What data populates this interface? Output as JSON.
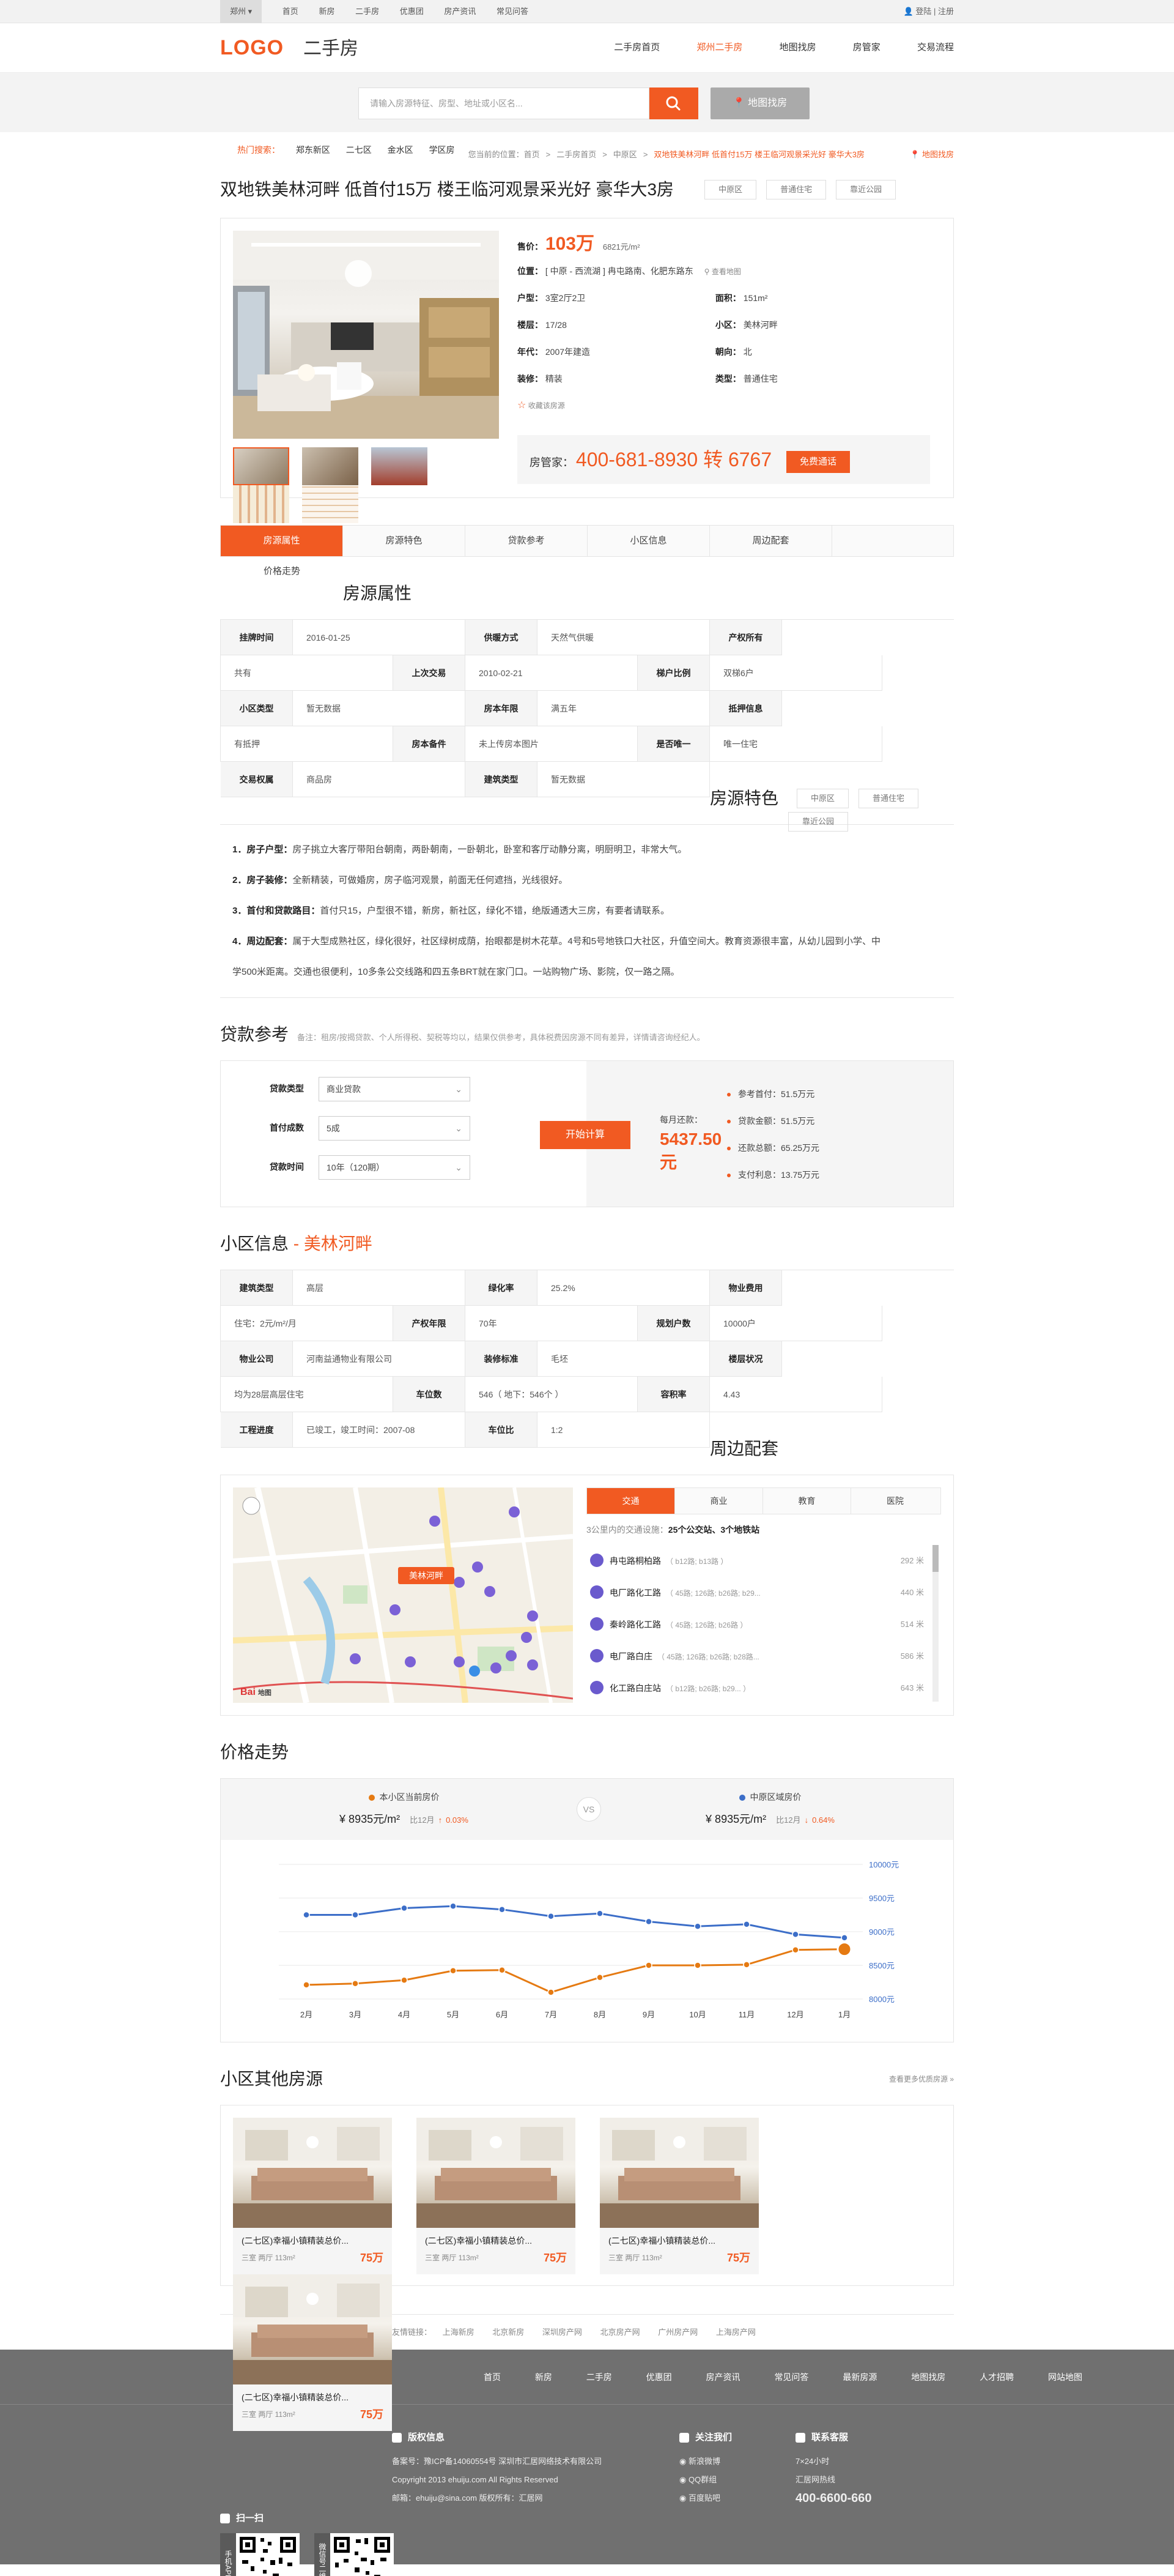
{
  "topbar": {
    "city": "郑州",
    "links": [
      "首页",
      "新房",
      "二手房",
      "优惠团",
      "房产资讯",
      "常见问答"
    ],
    "login": "登陆",
    "sep": "|",
    "register": "注册"
  },
  "header": {
    "logo": "LOGO",
    "site_name": "二手房",
    "nav": [
      "二手房首页",
      "郑州二手房",
      "地图找房",
      "房管家",
      "交易流程"
    ],
    "nav_active": 1
  },
  "search": {
    "placeholder": "请输入房源特征、房型、地址或小区名...",
    "map_button": "地图找房",
    "hot_label": "热门搜索：",
    "hot": [
      "郑东新区",
      "二七区",
      "金水区",
      "学区房"
    ]
  },
  "breadcrumb": {
    "prefix": "您当前的位置：",
    "items": [
      "首页",
      "二手房首页",
      "中原区"
    ],
    "current": "双地铁美林河畔 低首付15万 楼王临河观景采光好 豪华大3房",
    "map_link": "地图找房"
  },
  "listing": {
    "title": "双地铁美林河畔 低首付15万 楼王临河观景采光好 豪华大3房",
    "tags": [
      "中原区",
      "普通住宅",
      "靠近公园"
    ],
    "price_label": "售价：",
    "price": "103万",
    "unit_price": "6821元/m²",
    "location_label": "位置：",
    "location": "[ 中原 - 西流湖 ] 冉屯路南、化肥东路东",
    "map_link": "查看地图",
    "fields": [
      {
        "k": "户型：",
        "v": "3室2厅2卫",
        "k2": "面积：",
        "v2": "151m²"
      },
      {
        "k": "楼层：",
        "v": "17/28",
        "k2": "小区：",
        "v2": "美林河畔"
      },
      {
        "k": "年代：",
        "v": "2007年建造",
        "k2": "朝向：",
        "v2": "北"
      },
      {
        "k": "装修：",
        "v": "精装",
        "k2": "类型：",
        "v2": "普通住宅"
      }
    ],
    "favorite": "收藏该房源",
    "agent_label": "房管家：",
    "phone": "400-681-8930 转 6767",
    "call_button": "免费通话"
  },
  "tabs": [
    "房源属性",
    "房源特色",
    "贷款参考",
    "小区信息",
    "周边配套",
    "价格走势"
  ],
  "attributes": {
    "title": "房源属性",
    "rows": [
      [
        "挂牌时间",
        "2016-01-25",
        "供暖方式",
        "天然气供暖",
        "产权所有",
        "共有"
      ],
      [
        "上次交易",
        "2010-02-21",
        "梯户比例",
        "双梯6户",
        "小区类型",
        "暂无数据"
      ],
      [
        "房本年限",
        "满五年",
        "抵押信息",
        "有抵押",
        "房本备件",
        "未上传房本图片"
      ],
      [
        "是否唯一",
        "唯一住宅",
        "交易权属",
        "商品房",
        "建筑类型",
        "暂无数据"
      ]
    ]
  },
  "features": {
    "title": "房源特色",
    "tags": [
      "中原区",
      "普通住宅",
      "靠近公园"
    ],
    "items": [
      {
        "k": "1．房子户型：",
        "v": "房子挑立大客厅带阳台朝南，两卧朝南，一卧朝北，卧室和客厅动静分离，明厨明卫，非常大气。"
      },
      {
        "k": "2．房子装修：",
        "v": "全新精装，可做婚房，房子临河观景，前面无任何遮挡，光线很好。"
      },
      {
        "k": "3．首付和贷款路目：",
        "v": "首付只15，户型很不错，新房，新社区，绿化不错，绝版通透大三房，有要者请联系。"
      },
      {
        "k": "4．周边配套：",
        "v": "属于大型成熟社区，绿化很好，社区绿树成荫，抬眼都是树木花草。4号和5号地铁口大社区，升值空间大。教育资源很丰富，从幼儿园到小学、中"
      },
      {
        "k": "",
        "v": "学500米距离。交通也很便利，10多条公交线路和四五条BRT就在家门口。一站购物广场、影院，仅一路之隔。"
      }
    ]
  },
  "loan": {
    "title": "贷款参考",
    "note": "备注：租房/按揭贷款、个人所得税、契税等均以，结果仅供参考，具体税费因房源不同有差异，详情请咨询经纪人。",
    "fields": [
      {
        "k": "贷款类型",
        "v": "商业贷款"
      },
      {
        "k": "首付成数",
        "v": "5成"
      },
      {
        "k": "贷款时间",
        "v": "10年（120期）"
      }
    ],
    "calc_button": "开始计算",
    "monthly_label": "每月还款：",
    "monthly": "5437.50 元",
    "results": [
      {
        "k": "参考首付：",
        "v": "51.5万元"
      },
      {
        "k": "贷款金额：",
        "v": "51.5万元"
      },
      {
        "k": "还款总额：",
        "v": "65.25万元"
      },
      {
        "k": "支付利息：",
        "v": "13.75万元"
      }
    ]
  },
  "community": {
    "title": "小区信息",
    "dash": " - ",
    "name": "美林河畔",
    "rows": [
      [
        "建筑类型",
        "高层",
        "绿化率",
        "25.2%",
        "物业费用",
        "住宅：2元/m²/月"
      ],
      [
        "产权年限",
        "70年",
        "规划户数",
        "10000户",
        "物业公司",
        "河南益通物业有限公司"
      ],
      [
        "装修标准",
        "毛坯",
        "楼层状况",
        "均为28层高层住宅",
        "车位数",
        "546（ 地下：546个 ）"
      ],
      [
        "容积率",
        "4.43",
        "工程进度",
        "已竣工，竣工时间：2007-08",
        "车位比",
        "1:2"
      ]
    ]
  },
  "surroundings": {
    "title": "周边配套",
    "map_label": "美林河畔",
    "map_brand": "Bai",
    "map_brand_cn": "地图",
    "tabs": [
      "交通",
      "商业",
      "教育",
      "医院"
    ],
    "summary_prefix": "3公里内的交通设施：",
    "summary": "25个公交站、3个地铁站",
    "stations": [
      {
        "name": "冉屯路桐柏路",
        "lines": "（ b12路; b13路 ）",
        "dist": "292 米"
      },
      {
        "name": "电厂路化工路",
        "lines": "（ 45路; 126路; b26路; b29...",
        "dist": "440 米"
      },
      {
        "name": "秦岭路化工路",
        "lines": "（ 45路; 126路; b26路 ）",
        "dist": "514 米"
      },
      {
        "name": "电厂路白庄",
        "lines": "（ 45路; 126路; b26路; b28路...",
        "dist": "586 米"
      },
      {
        "name": "化工路白庄站",
        "lines": "（ b12路; b26路; b29... ）",
        "dist": "643 米"
      }
    ]
  },
  "trend": {
    "title": "价格走势",
    "left": {
      "label": "本小区当前房价",
      "value": "¥ 8935元/m²",
      "compare": "比12月",
      "arrow": "↑",
      "change": "0.03%",
      "color": "#e57a12"
    },
    "vs": "VS",
    "right": {
      "label": "中原区域房价",
      "value": "¥ 8935元/m²",
      "compare": "比12月",
      "arrow": "↓",
      "change": "0.64%",
      "color": "#3c6ec8"
    }
  },
  "chart_data": {
    "type": "line",
    "categories": [
      "2月",
      "3月",
      "4月",
      "5月",
      "6月",
      "7月",
      "8月",
      "9月",
      "10月",
      "11月",
      "12月",
      "1月"
    ],
    "ylim": [
      8000,
      10000
    ],
    "yticks": [
      "10000元",
      "9500元",
      "9000元",
      "8500元",
      "8000元"
    ],
    "series": [
      {
        "values": [
          9250,
          9250,
          9350,
          9380,
          9330,
          9230,
          9270,
          9150,
          9080,
          9110,
          8960,
          8910
        ],
        "color": "#3c6ec8"
      },
      {
        "values": [
          8210,
          8230,
          8280,
          8420,
          8430,
          8100,
          8320,
          8500,
          8500,
          8510,
          8730,
          8740
        ],
        "color": "#e57a12"
      }
    ]
  },
  "others": {
    "title": "小区其他房源",
    "more": "查看更多优质房源 »",
    "cards": [
      {
        "title": "(二七区)幸福小镇精装总价...",
        "meta": "三室 两厅   113m²",
        "price": "75万"
      },
      {
        "title": "(二七区)幸福小镇精装总价...",
        "meta": "三室 两厅   113m²",
        "price": "75万"
      },
      {
        "title": "(二七区)幸福小镇精装总价...",
        "meta": "三室 两厅   113m²",
        "price": "75万"
      },
      {
        "title": "(二七区)幸福小镇精装总价...",
        "meta": "三室 两厅   113m²",
        "price": "75万"
      }
    ]
  },
  "friend_links": {
    "label": "友情链接：",
    "items": [
      "上海新房",
      "北京新房",
      "深圳房产网",
      "北京房产网",
      "广州房产网",
      "上海房产网"
    ]
  },
  "footer": {
    "nav": [
      "首页",
      "新房",
      "二手房",
      "优惠团",
      "房产资讯",
      "常见问答",
      "最新房源",
      "地图找房",
      "人才招聘",
      "网站地图"
    ],
    "copyright_title": "版权信息",
    "copyright": [
      "备案号：豫ICP备14060554号   深圳市汇居网络技术有限公司",
      "Copyright 2013 ehuiju.com All Rights Reserved",
      "邮箱：ehuiju@sina.com  版权所有：汇居网"
    ],
    "follow_title": "关注我们",
    "follow": [
      "新浪微博",
      "QQ群组",
      "百度贴吧"
    ],
    "contact_title": "联系客服",
    "contact": [
      "7×24小时",
      "汇居网热线"
    ],
    "hotline": "400-6600-660",
    "scan_title": "扫一扫",
    "qr_labels": [
      "手机APP",
      "微信号二维码"
    ]
  }
}
